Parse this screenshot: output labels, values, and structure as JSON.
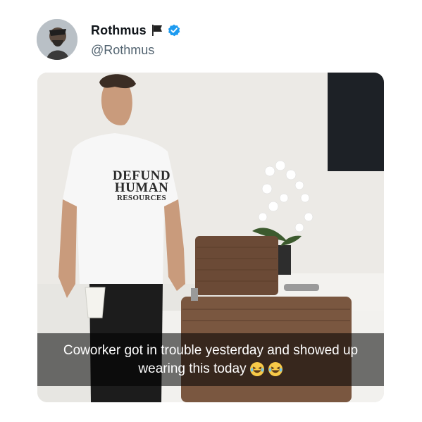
{
  "tweet": {
    "display_name": "Rothmus",
    "handle": "@Rothmus",
    "icons": [
      "avatar",
      "flag-icon",
      "verified-icon"
    ],
    "verified_color": "#1d9bf0"
  },
  "media": {
    "shirt_lines": [
      "DEFUND",
      "HUMAN",
      "RESOURCES"
    ],
    "caption_line1": "Coworker got in trouble yesterday and showed up",
    "caption_line2": "wearing this today",
    "caption_emojis": [
      "laughing-emoji-icon",
      "laughing-emoji-icon"
    ]
  }
}
